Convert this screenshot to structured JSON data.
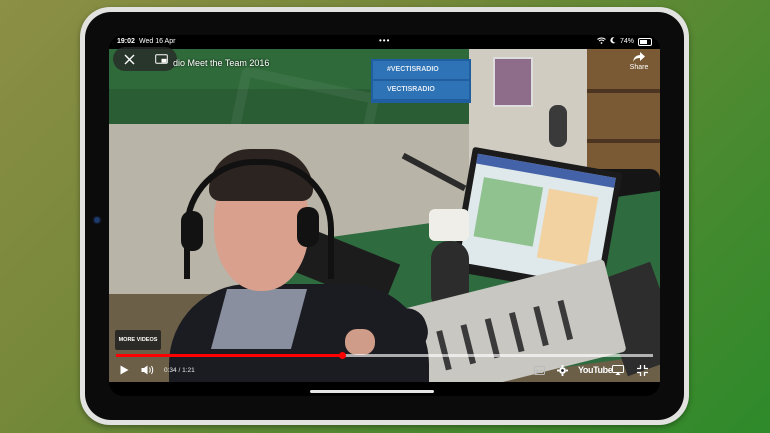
{
  "status_bar": {
    "time": "19:02",
    "date": "Wed 16 Apr",
    "multitask_dots": "•••",
    "battery_percent": "74%",
    "battery_level": 0.74
  },
  "video": {
    "title": "dio Meet the Team 2016",
    "poster_lines": [
      "#VECTISRADIO",
      "VECTISRADIO"
    ],
    "share_label": "Share",
    "more_videos_label": "MORE VIDEOS",
    "time_current": "0:34",
    "time_total": "1:21",
    "time_display": "0:34 / 1:21",
    "progress_fraction": 0.42,
    "loaded_fraction": 1.0,
    "youtube_label": "YouTube"
  },
  "colors": {
    "progress_played": "#ff0000",
    "background_start": "#8c8f46",
    "background_end": "#2d8a2a"
  },
  "icons": {
    "close": "close-icon",
    "pip": "picture-in-picture-icon",
    "share": "share-icon",
    "play": "play-icon",
    "volume": "volume-icon",
    "captions": "captions-icon",
    "settings": "gear-icon",
    "cast": "airplay-icon",
    "fullscreen_exit": "exit-fullscreen-icon"
  }
}
